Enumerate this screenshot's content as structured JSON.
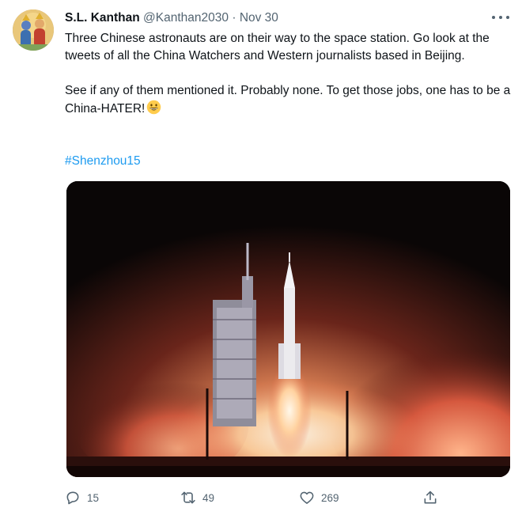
{
  "tweet": {
    "author_name": "S.L. Kanthan",
    "handle": "@Kanthan2030",
    "separator": "·",
    "date": "Nov 30",
    "paragraph1": "Three Chinese astronauts are on their way to the space station. Go look at the tweets of all the China Watchers and Western journalists based in Beijing.",
    "paragraph2": "See if any of them mentioned it. Probably none. To get those jobs, one has to be a China-HATER!",
    "emoji": "grinning-face-emoji",
    "hashtag": "#Shenzhou15",
    "counts": {
      "replies": "15",
      "retweets": "49",
      "likes": "269"
    }
  },
  "icons": {
    "more": "more-horizontal-icon",
    "reply": "reply-icon",
    "retweet": "retweet-icon",
    "like": "heart-icon",
    "share": "share-icon"
  },
  "colors": {
    "link": "#1d9bf0",
    "secondary_text": "#536471",
    "primary_text": "#0f1419"
  }
}
